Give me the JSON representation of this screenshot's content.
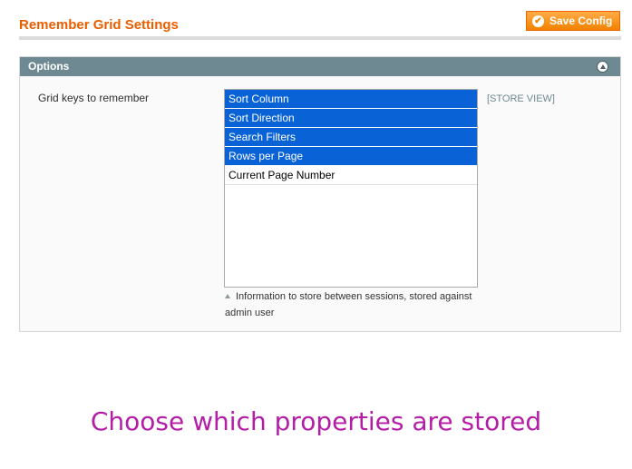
{
  "header": {
    "title": "Remember Grid Settings",
    "save_label": "Save Config"
  },
  "options_section": {
    "title": "Options",
    "field_label": "Grid keys to remember",
    "scope": "[STORE VIEW]",
    "items": [
      {
        "label": "Sort Column",
        "selected": true
      },
      {
        "label": "Sort Direction",
        "selected": true
      },
      {
        "label": "Search Filters",
        "selected": true
      },
      {
        "label": "Rows per Page",
        "selected": true
      },
      {
        "label": "Current Page Number",
        "selected": false
      }
    ],
    "note": "Information to store between sessions, stored against admin user"
  },
  "caption": "Choose which properties are stored",
  "colors": {
    "accent": "#eb5e00",
    "section_header": "#6f8992",
    "selection": "#0a63d6",
    "caption": "#b41ea6"
  }
}
